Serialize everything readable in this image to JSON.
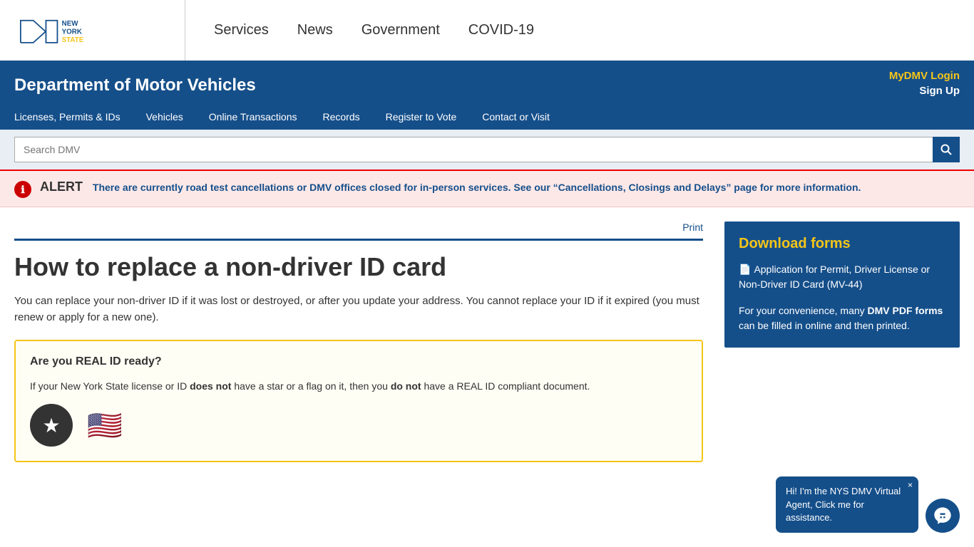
{
  "topnav": {
    "logo_alt": "New York State",
    "nav_links": [
      {
        "label": "Services",
        "id": "services"
      },
      {
        "label": "News",
        "id": "news"
      },
      {
        "label": "Government",
        "id": "government"
      },
      {
        "label": "COVID-19",
        "id": "covid19"
      }
    ]
  },
  "dmv_header": {
    "title": "Department of Motor Vehicles",
    "mydmv_login": "MyDMV Login",
    "signup": "Sign Up",
    "nav_items": [
      "Licenses, Permits & IDs",
      "Vehicles",
      "Online Transactions",
      "Records",
      "Register to Vote",
      "Contact or Visit"
    ]
  },
  "search": {
    "placeholder": "Search DMV",
    "button_label": "Search"
  },
  "alert": {
    "label": "ALERT",
    "text": "There are currently road test cancellations or DMV offices closed for in-person services. See our “Cancellations, Closings and Delays” page for more information."
  },
  "page": {
    "print_label": "Print",
    "title": "How to replace a non-driver ID card",
    "intro_p1": "You can replace your non-driver ID if it was lost or destroyed, or after you update your address. You cannot replace your ID if it expired (you must renew or apply for a new one)."
  },
  "realid": {
    "title": "Are you REAL ID ready?",
    "text_before": "If your New York State license or ID ",
    "does_not": "does not",
    "text_middle": " have a star or a flag on it, then you ",
    "do_not": "do not",
    "text_after": " have a REAL ID compliant document.",
    "star_emoji": "★",
    "flag_emoji": "🇺🇸"
  },
  "sidebar": {
    "download_forms": {
      "title": "Download forms",
      "link_label": "Application for Permit, Driver License or Non-Driver ID Card (MV-44)",
      "note_before": "For your convenience, many ",
      "note_link": "DMV PDF forms",
      "note_after": " can be filled in online and then printed."
    }
  },
  "chatbot": {
    "bubble_text": "Hi! I'm the NYS DMV Virtual Agent, Click me for assistance.",
    "close_label": "×"
  }
}
